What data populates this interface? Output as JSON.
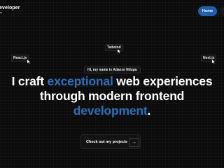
{
  "header": {
    "brand": "eveloper",
    "home_label": "Home"
  },
  "floating_tags": {
    "tailwind": "Tailwind",
    "react": "React.js",
    "next": "Next.js"
  },
  "hero": {
    "greeting": "Hi, my name is Adaeze Ndupu",
    "line1_a": "I craft ",
    "line1_accent": "exceptional",
    "line1_b": " web experiences",
    "line2": "through modern frontend",
    "line3_accent": "development",
    "line3_end": "."
  },
  "cta": {
    "label": "Check out my projects",
    "arrow": "→"
  },
  "colors": {
    "background": "#0b0b0c",
    "accent": "#2f6fb8",
    "home_button": "#1f5fae"
  },
  "icons": [
    "cursor-icon",
    "arrow-right-icon",
    "menu-icon"
  ]
}
